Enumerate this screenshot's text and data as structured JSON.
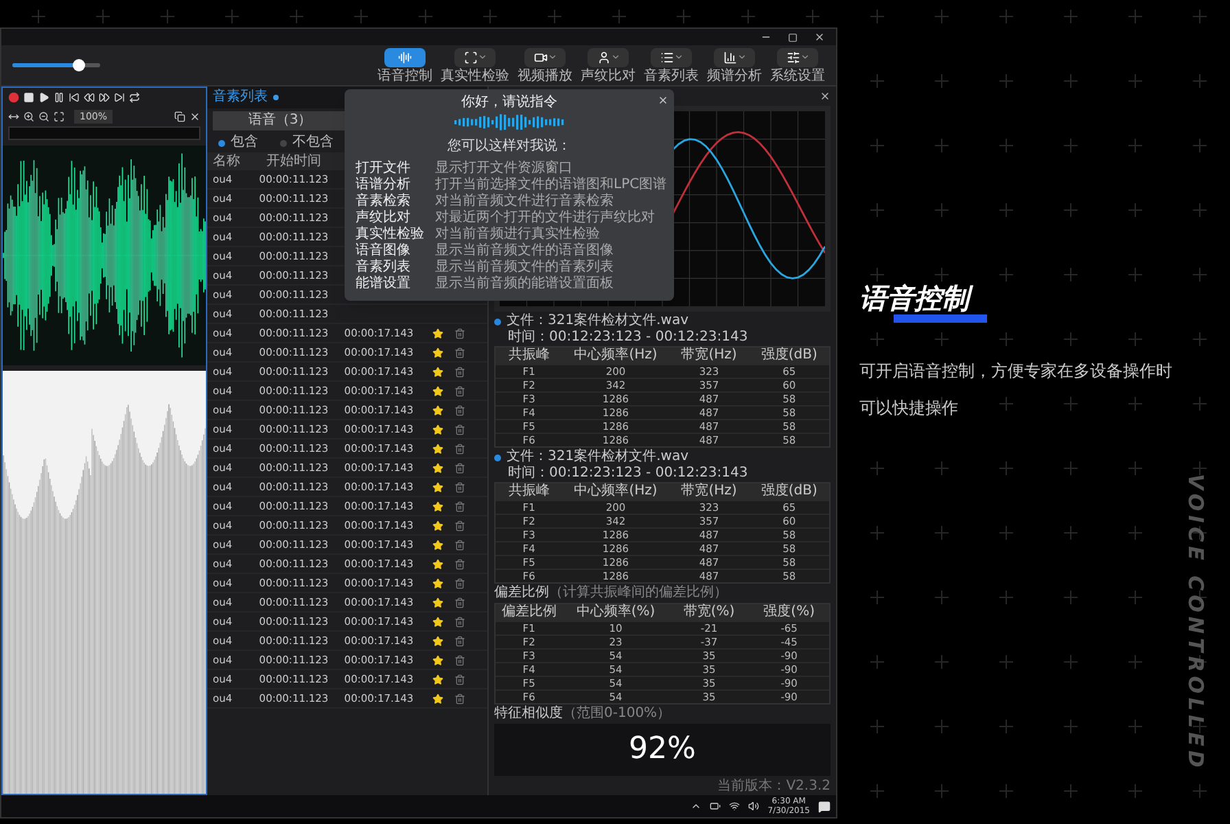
{
  "toolbar": {
    "zoom_slider": {
      "level": 0.75
    },
    "tools": [
      {
        "label": "语音控制",
        "kind": "voice",
        "selected": true
      },
      {
        "label": "真实性检验",
        "kind": "frame",
        "selected": false
      },
      {
        "label": "视频播放",
        "kind": "camera",
        "selected": false
      },
      {
        "label": "声纹比对",
        "kind": "person",
        "selected": false
      },
      {
        "label": "音素列表",
        "kind": "list",
        "selected": false
      },
      {
        "label": "频谱分析",
        "kind": "bars",
        "selected": false
      },
      {
        "label": "系统设置",
        "kind": "settings",
        "selected": false
      }
    ]
  },
  "waveform_panel": {
    "zoom": "100%"
  },
  "voice_popup": {
    "title": "你好，请说指令",
    "hint": "您可以这样对我说：",
    "commands": [
      {
        "command": "打开文件",
        "description": "显示打开文件资源窗口"
      },
      {
        "command": "语谱分析",
        "description": "打开当前选择文件的语谱图和LPC图谱"
      },
      {
        "command": "音素检索",
        "description": "对当前音频文件进行音素检索"
      },
      {
        "command": "声纹比对",
        "description": "对最近两个打开的文件进行声纹比对"
      },
      {
        "command": "真实性检验",
        "description": "对当前音频进行真实性检验"
      },
      {
        "command": "语音图像",
        "description": "显示当前音频文件的语音图像"
      },
      {
        "command": "音素列表",
        "description": "显示当前音频文件的音素列表"
      },
      {
        "command": "能谱设置",
        "description": "显示当前音频的能谱设置面板"
      }
    ]
  },
  "phoneme_list": {
    "tab": "音素列表",
    "filter_tab": "语音（3）",
    "filters": [
      {
        "label": "包含",
        "selected": true
      },
      {
        "label": "不包含",
        "selected": false
      }
    ],
    "columns": [
      "名称",
      "开始时间"
    ],
    "rows": [
      {
        "name": "ou4",
        "start": "00:00:11.123"
      },
      {
        "name": "ou4",
        "start": "00:00:11.123"
      },
      {
        "name": "ou4",
        "start": "00:00:11.123"
      },
      {
        "name": "ou4",
        "start": "00:00:11.123"
      },
      {
        "name": "ou4",
        "start": "00:00:11.123"
      },
      {
        "name": "ou4",
        "start": "00:00:11.123"
      },
      {
        "name": "ou4",
        "start": "00:00:11.123"
      },
      {
        "name": "ou4",
        "start": "00:00:11.123"
      },
      {
        "name": "ou4",
        "start": "00:00:11.123",
        "end": "00:00:17.143",
        "starred": true
      },
      {
        "name": "ou4",
        "start": "00:00:11.123",
        "end": "00:00:17.143",
        "starred": true
      },
      {
        "name": "ou4",
        "start": "00:00:11.123",
        "end": "00:00:17.143",
        "starred": true
      },
      {
        "name": "ou4",
        "start": "00:00:11.123",
        "end": "00:00:17.143",
        "starred": true
      },
      {
        "name": "ou4",
        "start": "00:00:11.123",
        "end": "00:00:17.143",
        "starred": true
      },
      {
        "name": "ou4",
        "start": "00:00:11.123",
        "end": "00:00:17.143",
        "starred": true
      },
      {
        "name": "ou4",
        "start": "00:00:11.123",
        "end": "00:00:17.143",
        "starred": true
      },
      {
        "name": "ou4",
        "start": "00:00:11.123",
        "end": "00:00:17.143",
        "starred": true
      },
      {
        "name": "ou4",
        "start": "00:00:11.123",
        "end": "00:00:17.143",
        "starred": true
      },
      {
        "name": "ou4",
        "start": "00:00:11.123",
        "end": "00:00:17.143",
        "starred": true
      },
      {
        "name": "ou4",
        "start": "00:00:11.123",
        "end": "00:00:17.143",
        "starred": true
      },
      {
        "name": "ou4",
        "start": "00:00:11.123",
        "end": "00:00:17.143",
        "starred": true
      },
      {
        "name": "ou4",
        "start": "00:00:11.123",
        "end": "00:00:17.143",
        "starred": true
      },
      {
        "name": "ou4",
        "start": "00:00:11.123",
        "end": "00:00:17.143",
        "starred": true
      },
      {
        "name": "ou4",
        "start": "00:00:11.123",
        "end": "00:00:17.143",
        "starred": true
      },
      {
        "name": "ou4",
        "start": "00:00:11.123",
        "end": "00:00:17.143",
        "starred": true
      },
      {
        "name": "ou4",
        "start": "00:00:11.123",
        "end": "00:00:17.143",
        "starred": true
      },
      {
        "name": "ou4",
        "start": "00:00:11.123",
        "end": "00:00:17.143",
        "starred": true
      },
      {
        "name": "ou4",
        "start": "00:00:11.123",
        "end": "00:00:17.143",
        "starred": true
      },
      {
        "name": "ou4",
        "start": "00:00:11.123",
        "end": "00:00:17.143",
        "starred": true
      }
    ]
  },
  "analysis": {
    "formant_tables": [
      {
        "file": "文件：321案件检材文件.wav",
        "time": "时间：00:12:23:123 - 00:12:23:143",
        "columns": [
          "共振峰",
          "中心频率(Hz)",
          "带宽(Hz)",
          "强度(dB)"
        ],
        "rows": [
          [
            "F1",
            "200",
            "323",
            "65"
          ],
          [
            "F2",
            "342",
            "357",
            "60"
          ],
          [
            "F3",
            "1286",
            "487",
            "58"
          ],
          [
            "F4",
            "1286",
            "487",
            "58"
          ],
          [
            "F5",
            "1286",
            "487",
            "58"
          ],
          [
            "F6",
            "1286",
            "487",
            "58"
          ]
        ]
      },
      {
        "file": "文件：321案件检材文件.wav",
        "time": "时间：00:12:23:123 - 00:12:23:143",
        "columns": [
          "共振峰",
          "中心频率(Hz)",
          "带宽(Hz)",
          "强度(dB)"
        ],
        "rows": [
          [
            "F1",
            "200",
            "323",
            "65"
          ],
          [
            "F2",
            "342",
            "357",
            "60"
          ],
          [
            "F3",
            "1286",
            "487",
            "58"
          ],
          [
            "F4",
            "1286",
            "487",
            "58"
          ],
          [
            "F5",
            "1286",
            "487",
            "58"
          ],
          [
            "F6",
            "1286",
            "487",
            "58"
          ]
        ]
      }
    ],
    "deviation": {
      "title": "偏差比例",
      "note": "（计算共振峰间的偏差比例）",
      "columns": [
        "偏差比例",
        "中心频率(%)",
        "带宽(%)",
        "强度(%)"
      ],
      "rows": [
        [
          "F1",
          "10",
          "-21",
          "-65"
        ],
        [
          "F2",
          "23",
          "-37",
          "-45"
        ],
        [
          "F3",
          "54",
          "35",
          "-90"
        ],
        [
          "F4",
          "54",
          "35",
          "-90"
        ],
        [
          "F5",
          "54",
          "35",
          "-90"
        ],
        [
          "F6",
          "54",
          "35",
          "-90"
        ]
      ]
    },
    "similarity": {
      "title": "特征相似度",
      "note": "（范围0-100%）",
      "value": "92%"
    },
    "version": "当前版本：V2.3.2"
  },
  "taskbar": {
    "time": "6:30 AM",
    "date": "7/30/2015"
  },
  "feature": {
    "heading": "语音控制",
    "body": "可开启语音控制，方便专家在多设备操作时可以快捷操作",
    "side_text": "VOICE CONTROLLED"
  }
}
